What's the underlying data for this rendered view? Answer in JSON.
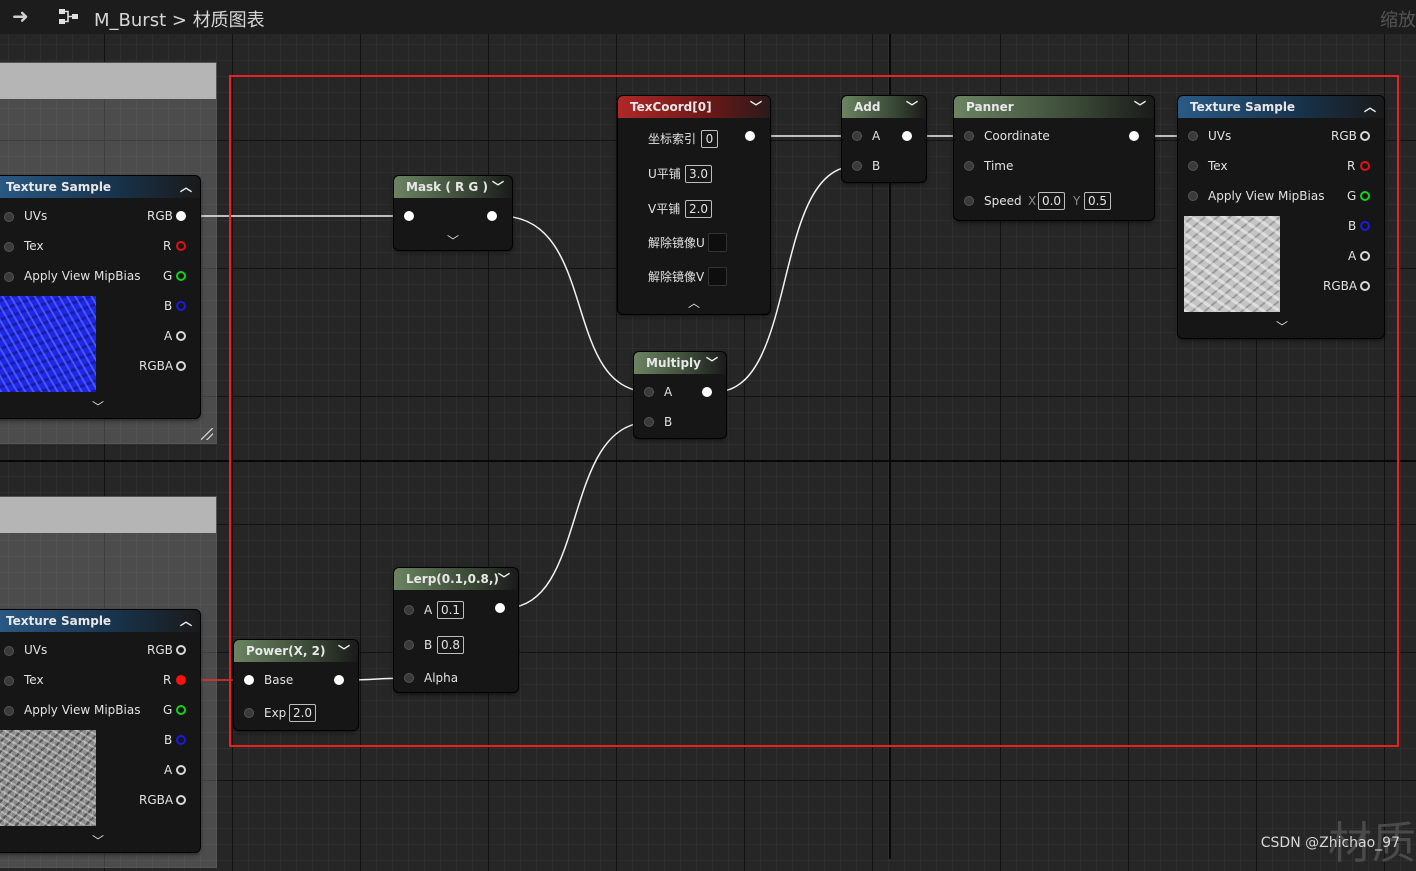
{
  "topbar": {
    "back_icon": "back-arrow-icon",
    "graph_icon": "material-graph-icon",
    "asset_name": "M_Burst",
    "separator": ">",
    "graph_title": "材质图表",
    "zoom_label": "缩放"
  },
  "nodes": {
    "tex_left_top": {
      "title": "Texture Sample",
      "inputs": [
        "UVs",
        "Tex",
        "Apply View MipBias"
      ],
      "outputs": [
        "RGB",
        "R",
        "G",
        "B",
        "A",
        "RGBA"
      ]
    },
    "tex_left_bottom": {
      "title": "Texture Sample",
      "inputs": [
        "UVs",
        "Tex",
        "Apply View MipBias"
      ],
      "outputs": [
        "RGB",
        "R",
        "G",
        "B",
        "A",
        "RGBA"
      ]
    },
    "mask": {
      "title": "Mask ( R G )"
    },
    "texcoord": {
      "title": "TexCoord[0]",
      "index_label": "坐标索引",
      "index_value": "0",
      "u_label": "U平铺",
      "u_value": "3.0",
      "v_label": "V平铺",
      "v_value": "2.0",
      "unmirror_u": "解除镜像U",
      "unmirror_v": "解除镜像V"
    },
    "add": {
      "title": "Add",
      "a": "A",
      "b": "B"
    },
    "panner": {
      "title": "Panner",
      "coordinate": "Coordinate",
      "time": "Time",
      "speed": "Speed",
      "x_label": "X",
      "x_value": "0.0",
      "y_label": "Y",
      "y_value": "0.5"
    },
    "tex_right": {
      "title": "Texture Sample",
      "inputs": [
        "UVs",
        "Tex",
        "Apply View MipBias"
      ],
      "outputs": [
        "RGB",
        "R",
        "G",
        "B",
        "A",
        "RGBA"
      ]
    },
    "multiply": {
      "title": "Multiply",
      "a": "A",
      "b": "B"
    },
    "lerp": {
      "title": "Lerp(0.1,0.8,)",
      "a": "A",
      "a_value": "0.1",
      "b": "B",
      "b_value": "0.8",
      "alpha": "Alpha"
    },
    "power": {
      "title": "Power(X, 2)",
      "base": "Base",
      "exp": "Exp",
      "exp_value": "2.0"
    }
  },
  "colors": {
    "selection": "#e8231f",
    "texture_header": "#2a5a86",
    "math_header": "#6b8462",
    "texcoord_header": "#b02828"
  },
  "watermark": "CSDN @Zhichao_97",
  "watermark_large": "材质"
}
